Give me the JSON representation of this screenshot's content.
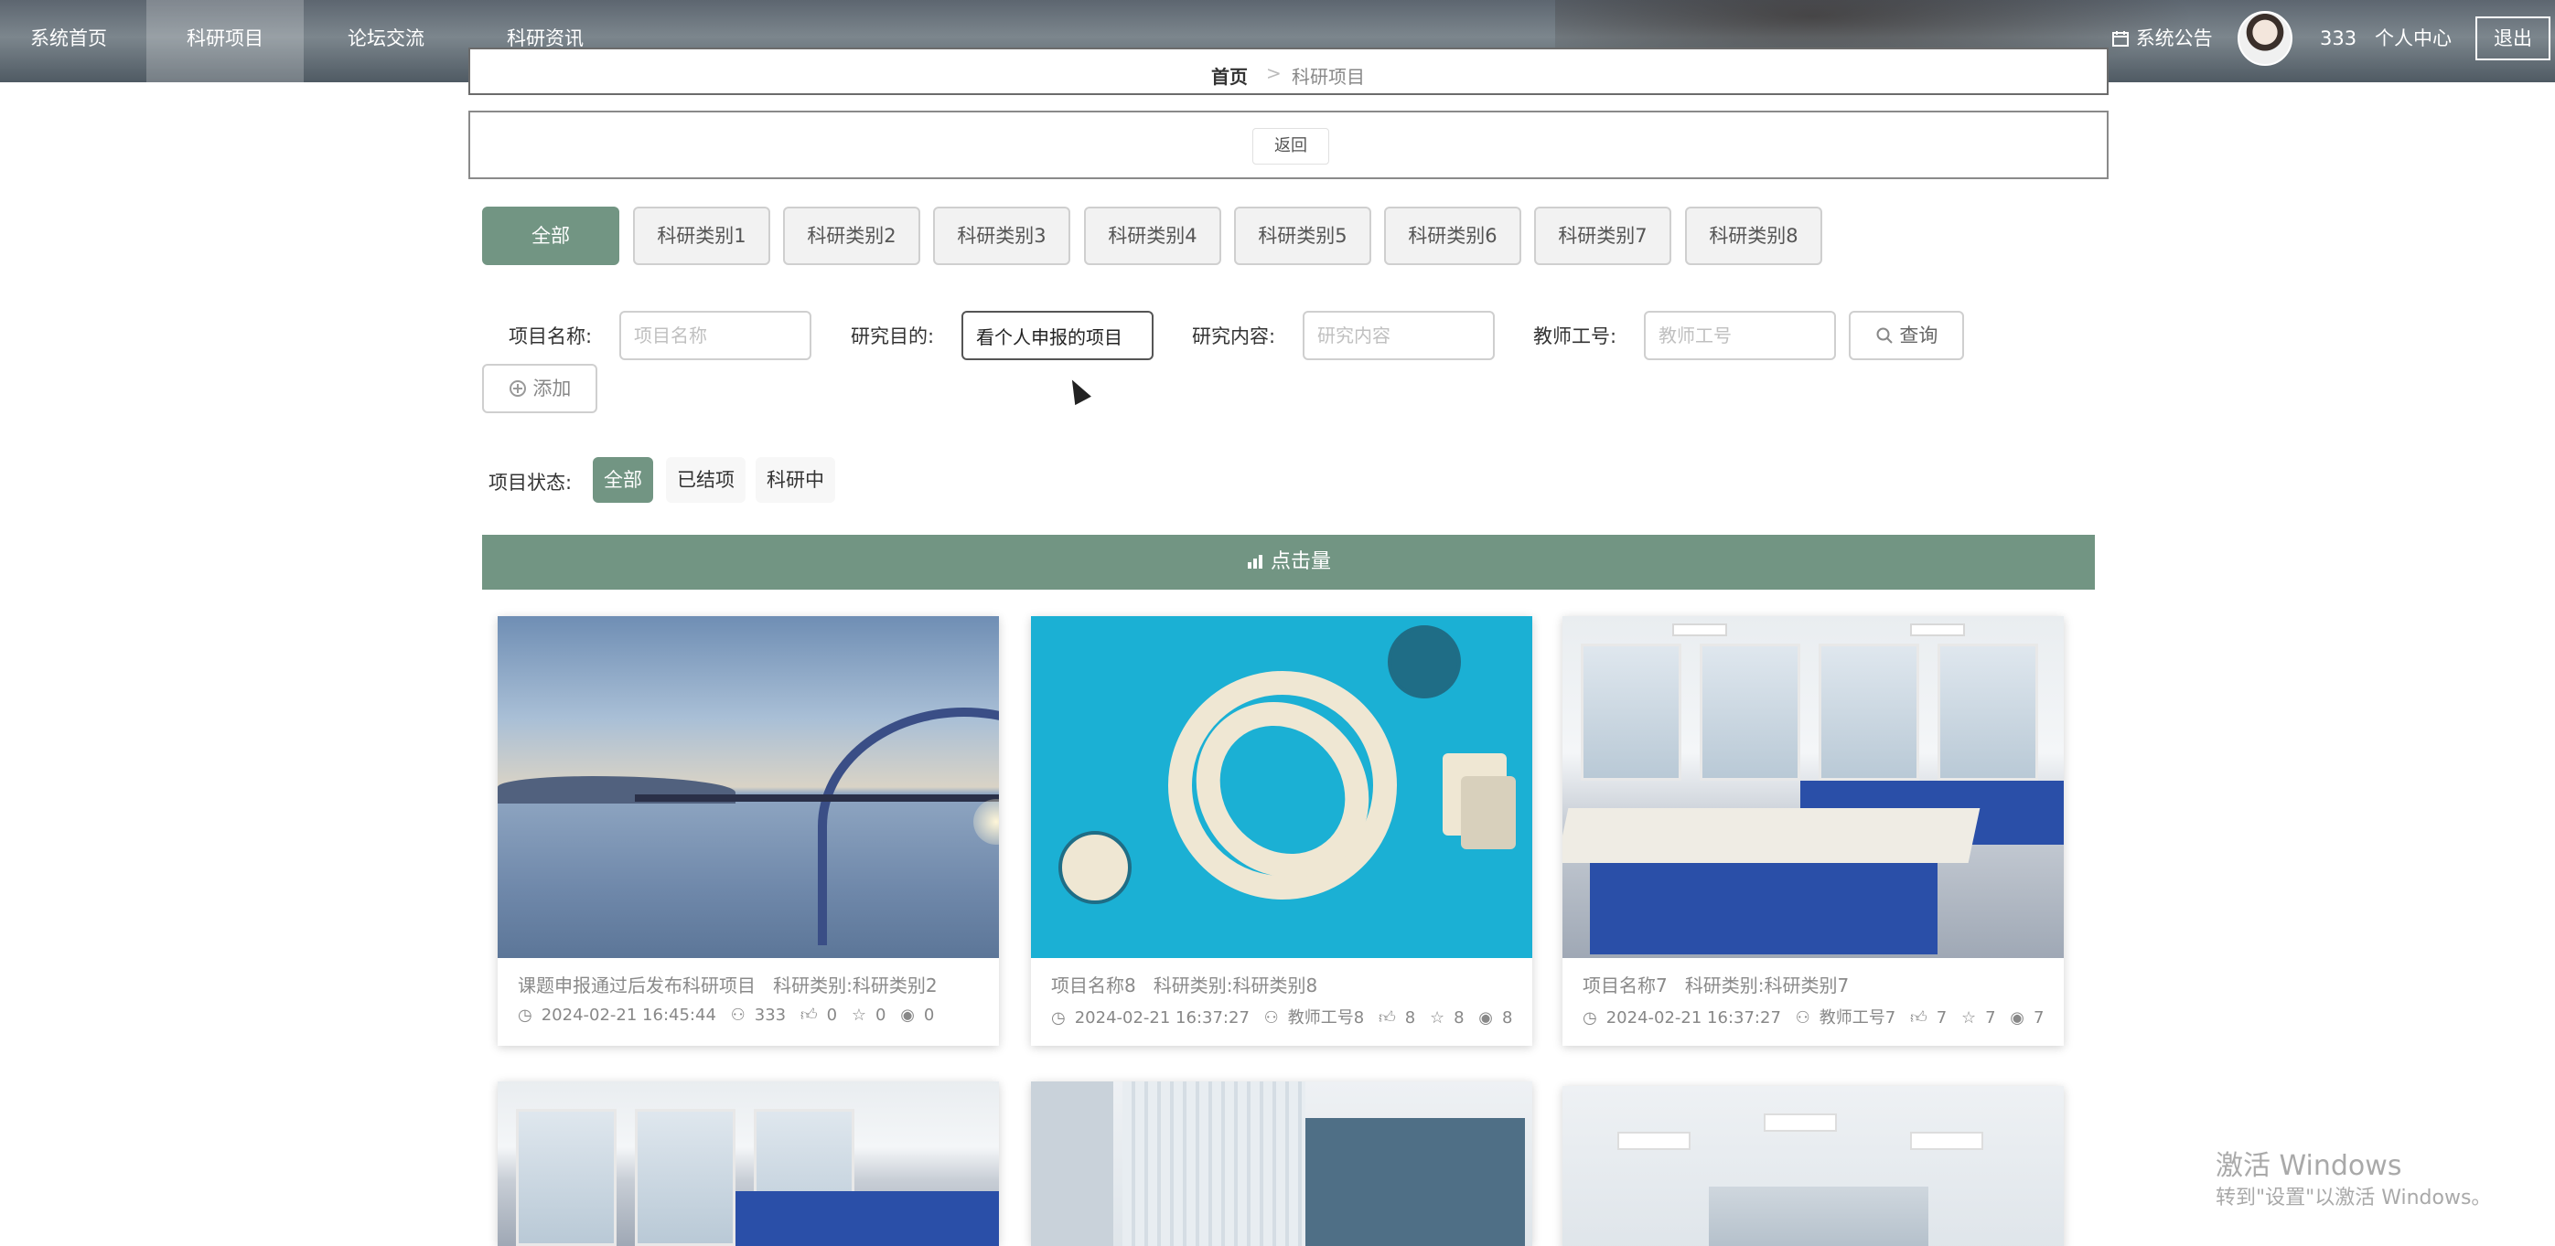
{
  "nav": {
    "items": [
      {
        "label": "系统首页"
      },
      {
        "label": "科研项目"
      },
      {
        "label": "论坛交流"
      },
      {
        "label": "科研资讯"
      }
    ],
    "notice_label": "系统公告",
    "username": "333",
    "personal_center": "个人中心",
    "logout": "退出"
  },
  "breadcrumb": {
    "home": "首页",
    "separator": ">",
    "current": "科研项目"
  },
  "back_label": "返回",
  "categories": [
    "全部",
    "科研类别1",
    "科研类别2",
    "科研类别3",
    "科研类别4",
    "科研类别5",
    "科研类别6",
    "科研类别7",
    "科研类别8"
  ],
  "search": {
    "name_label": "项目名称:",
    "name_placeholder": "项目名称",
    "purpose_label": "研究目的:",
    "purpose_value": "看个人申报的项目",
    "content_label": "研究内容:",
    "content_placeholder": "研究内容",
    "teacher_label": "教师工号:",
    "teacher_placeholder": "教师工号",
    "search_btn": "查询",
    "add_btn": "添加"
  },
  "status_filter": {
    "label": "项目状态:",
    "options": [
      "全部",
      "已结项",
      "科研中"
    ]
  },
  "sort_label": "点击量",
  "cards": [
    {
      "title": "课题申报通过后发布科研项目",
      "category": "科研类别:科研类别2",
      "time": "2024-02-21 16:45:44",
      "teacher": "333",
      "likes": "0",
      "favs": "0",
      "views": "0"
    },
    {
      "title": "项目名称8",
      "category": "科研类别:科研类别8",
      "time": "2024-02-21 16:37:27",
      "teacher": "教师工号8",
      "likes": "8",
      "favs": "8",
      "views": "8"
    },
    {
      "title": "项目名称7",
      "category": "科研类别:科研类别7",
      "time": "2024-02-21 16:37:27",
      "teacher": "教师工号7",
      "likes": "7",
      "favs": "7",
      "views": "7"
    }
  ],
  "watermark": {
    "line1": "激活 Windows",
    "line2": "转到\"设置\"以激活 Windows。"
  }
}
